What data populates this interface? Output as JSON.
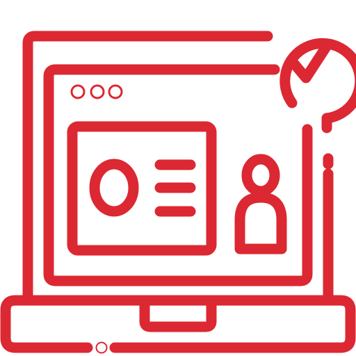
{
  "icon": {
    "name": "online-identity-verification-icon",
    "style": "line-art",
    "color": "#dc2832",
    "background": "#ffffff",
    "parts": [
      "laptop-icon",
      "browser-window-icon",
      "id-card-icon",
      "user-silhouette-icon",
      "check-badge-icon"
    ]
  }
}
